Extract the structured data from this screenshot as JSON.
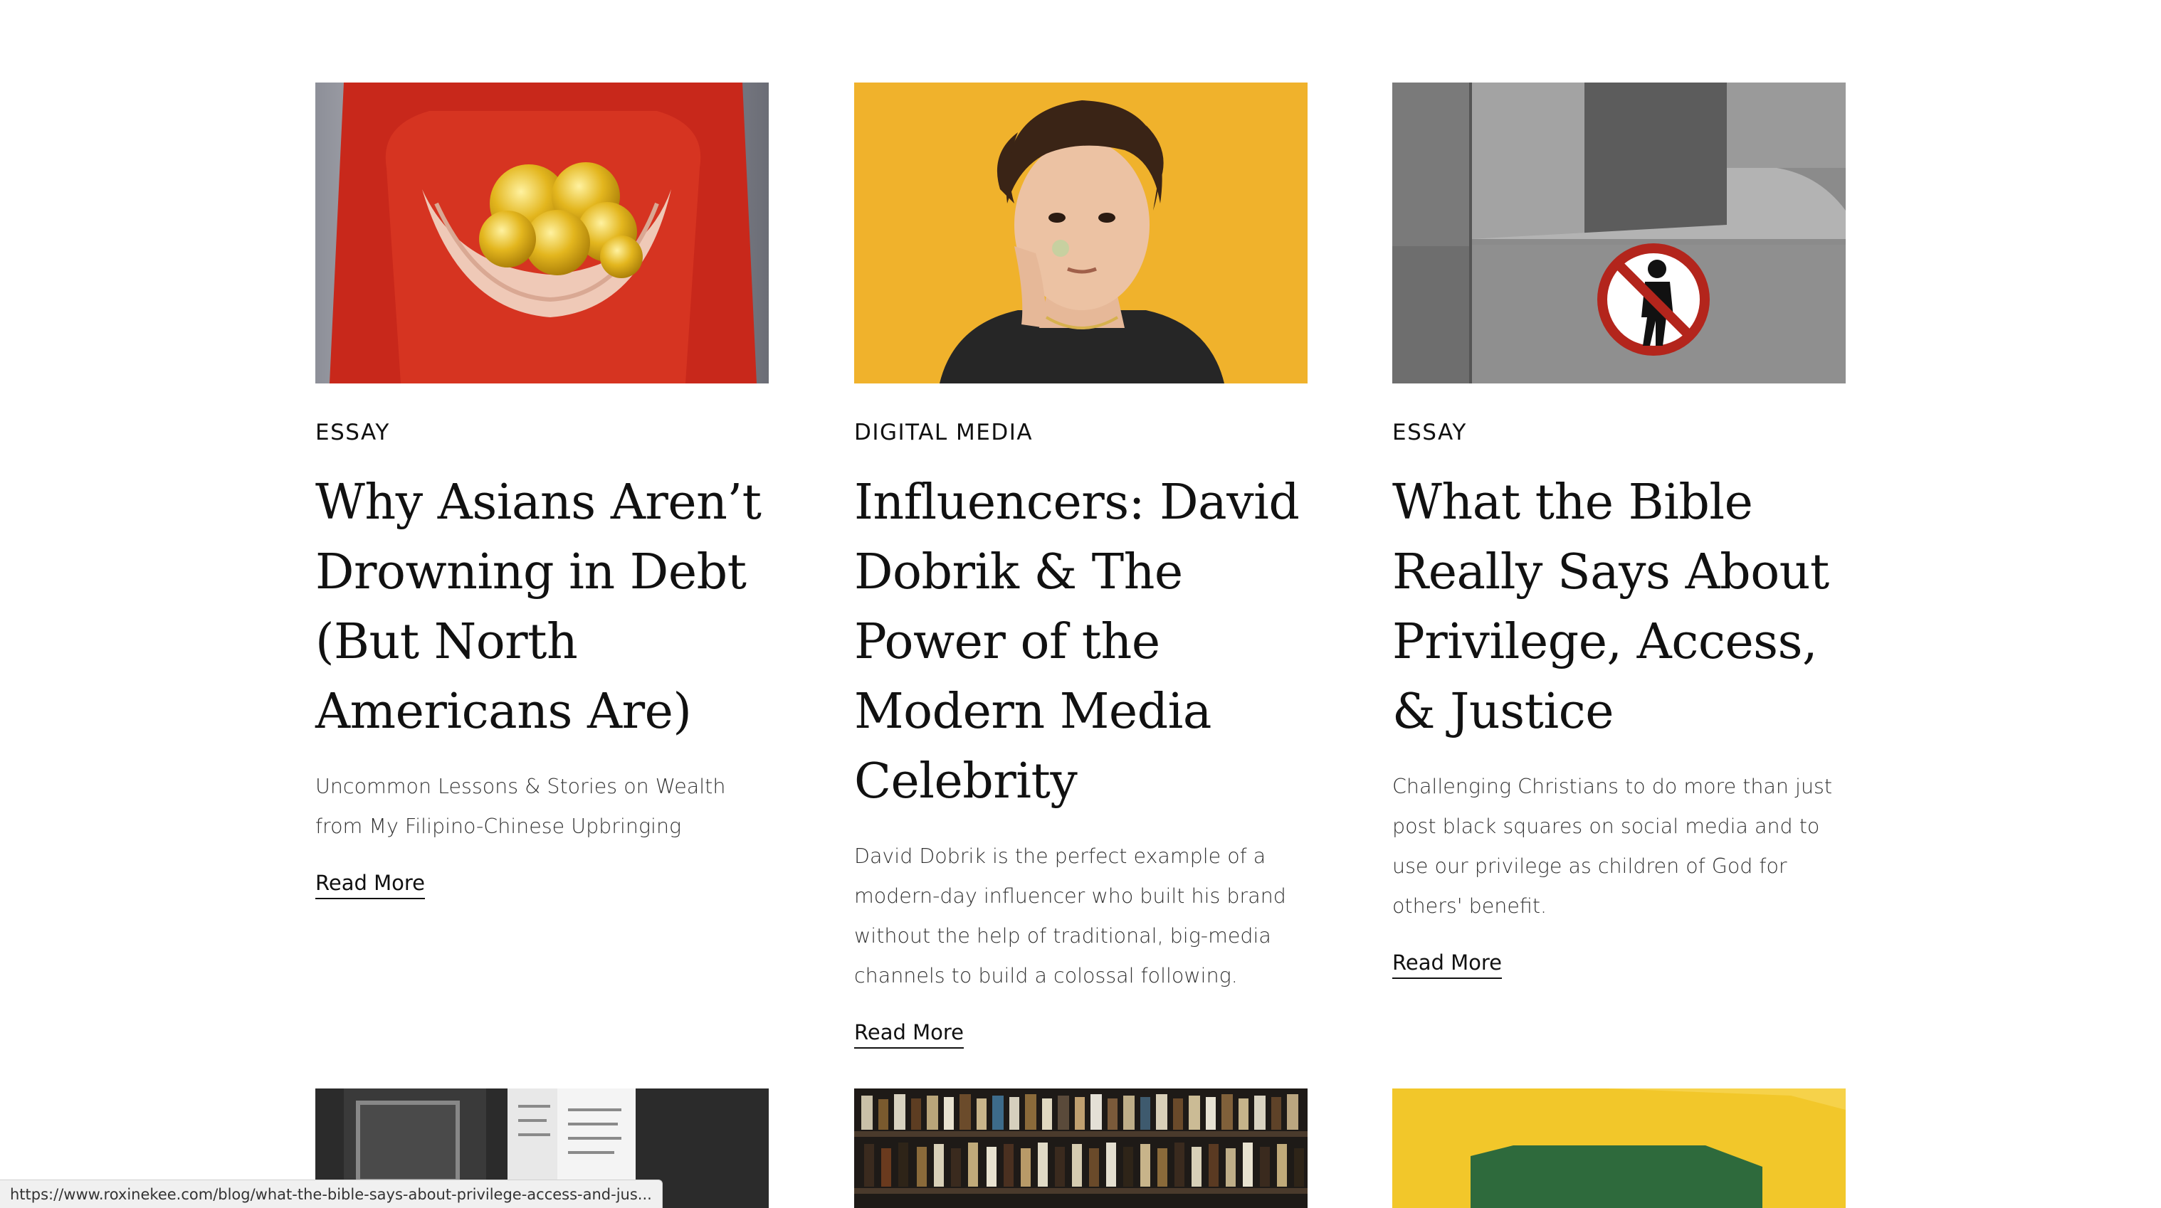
{
  "posts": [
    {
      "category": "ESSAY",
      "title": "Why Asians Aren’t Drowning in Debt (But North Americans Are)",
      "excerpt": "Uncommon Lessons & Stories on Wealth from My Filipino-Chinese Upbringing",
      "read_more": "Read More"
    },
    {
      "category": "DIGITAL MEDIA",
      "title": "Influencers: David Dobrik & The Power of the Modern Media Celebrity",
      "excerpt": "David Dobrik is the perfect example of a modern-day influencer who built his brand without the help of traditional, big-media channels to build a colossal following.",
      "read_more": "Read More"
    },
    {
      "category": "ESSAY",
      "title": "What the Bible Really Says About Privilege, Access, & Justice",
      "excerpt": "Challenging Christians to do more than just post black squares on social media and to use our privilege as children of God for others' benefit.",
      "read_more": "Read More"
    }
  ],
  "status_bar": {
    "url": "https://www.roxinekee.com/blog/what-the-bible-says-about-privilege-access-and-jus..."
  },
  "colors": {
    "text": "#111111",
    "excerpt": "#333333",
    "background": "#ffffff"
  }
}
